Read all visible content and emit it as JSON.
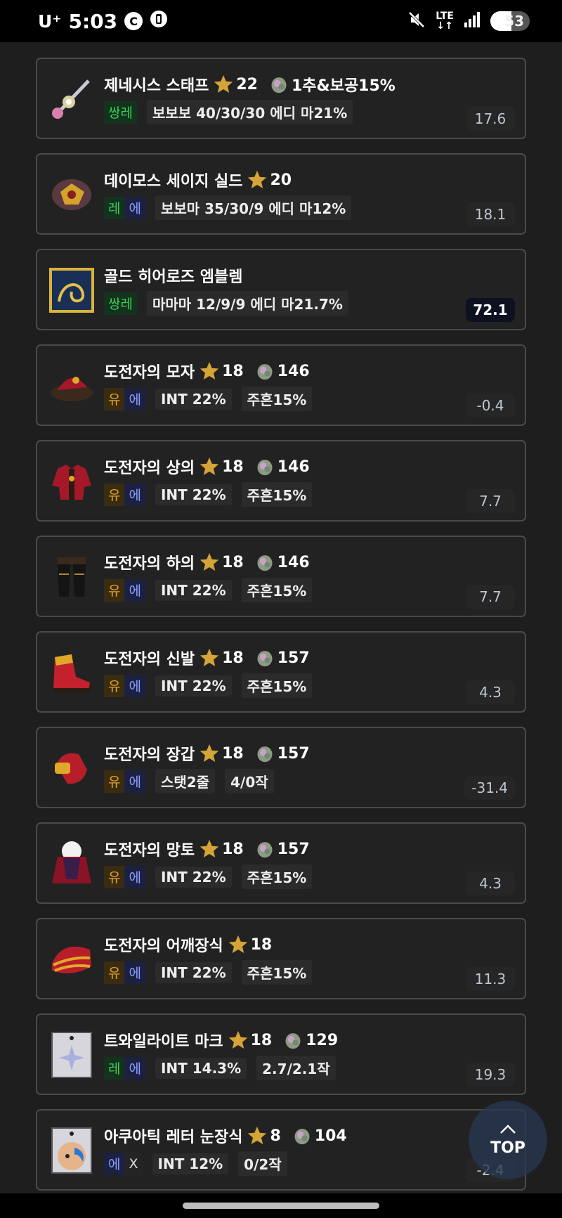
{
  "status_bar": {
    "carrier": "U⁺",
    "time": "5:03",
    "badge_c": "C",
    "lte_top": "LTE",
    "lte_bottom": "↓↑",
    "battery": "53",
    "battery_level": 0.53
  },
  "items": [
    {
      "name": "제네시스 스태프",
      "stars": "22",
      "add": "1추&보공15%",
      "tiers": [
        {
          "text": "쌍레",
          "type": "rare"
        }
      ],
      "stats": [
        "보보보 40/30/30 에디 마21%"
      ],
      "score": "17.6",
      "highlight": false,
      "icon": "staff-icon"
    },
    {
      "name": "데이모스 세이지 실드",
      "stars": "20",
      "add": "",
      "tiers": [
        {
          "text": "레",
          "type": "rare"
        },
        {
          "text": "에",
          "type": "epic"
        }
      ],
      "stats": [
        "보보마 35/30/9 에디 마12%"
      ],
      "score": "18.1",
      "highlight": false,
      "icon": "shield-icon"
    },
    {
      "name": "골드 히어로즈 엠블렘",
      "stars": "",
      "add": "",
      "tiers": [
        {
          "text": "쌍레",
          "type": "rare"
        }
      ],
      "stats": [
        "마마마 12/9/9 에디 마21.7%"
      ],
      "score": "72.1",
      "highlight": true,
      "icon": "emblem-icon"
    },
    {
      "name": "도전자의 모자",
      "stars": "18",
      "add": "146",
      "tiers": [
        {
          "text": "유",
          "type": "unique"
        },
        {
          "text": "에",
          "type": "epic"
        }
      ],
      "stats": [
        "INT 22%",
        "주흔15%"
      ],
      "score": "-0.4",
      "highlight": false,
      "icon": "hat-icon"
    },
    {
      "name": "도전자의 상의",
      "stars": "18",
      "add": "146",
      "tiers": [
        {
          "text": "유",
          "type": "unique"
        },
        {
          "text": "에",
          "type": "epic"
        }
      ],
      "stats": [
        "INT 22%",
        "주흔15%"
      ],
      "score": "7.7",
      "highlight": false,
      "icon": "top-armor-icon"
    },
    {
      "name": "도전자의 하의",
      "stars": "18",
      "add": "146",
      "tiers": [
        {
          "text": "유",
          "type": "unique"
        },
        {
          "text": "에",
          "type": "epic"
        }
      ],
      "stats": [
        "INT 22%",
        "주흔15%"
      ],
      "score": "7.7",
      "highlight": false,
      "icon": "pants-icon"
    },
    {
      "name": "도전자의 신발",
      "stars": "18",
      "add": "157",
      "tiers": [
        {
          "text": "유",
          "type": "unique"
        },
        {
          "text": "에",
          "type": "epic"
        }
      ],
      "stats": [
        "INT 22%",
        "주흔15%"
      ],
      "score": "4.3",
      "highlight": false,
      "icon": "shoes-icon"
    },
    {
      "name": "도전자의 장갑",
      "stars": "18",
      "add": "157",
      "tiers": [
        {
          "text": "유",
          "type": "unique"
        },
        {
          "text": "에",
          "type": "epic"
        }
      ],
      "stats": [
        "스탯2줄",
        "4/0작"
      ],
      "score": "-31.4",
      "highlight": false,
      "icon": "gloves-icon"
    },
    {
      "name": "도전자의 망토",
      "stars": "18",
      "add": "157",
      "tiers": [
        {
          "text": "유",
          "type": "unique"
        },
        {
          "text": "에",
          "type": "epic"
        }
      ],
      "stats": [
        "INT 22%",
        "주흔15%"
      ],
      "score": "4.3",
      "highlight": false,
      "icon": "cape-icon"
    },
    {
      "name": "도전자의 어깨장식",
      "stars": "18",
      "add": "",
      "tiers": [
        {
          "text": "유",
          "type": "unique"
        },
        {
          "text": "에",
          "type": "epic"
        }
      ],
      "stats": [
        "INT 22%",
        "주흔15%"
      ],
      "score": "11.3",
      "highlight": false,
      "icon": "shoulder-icon"
    },
    {
      "name": "트와일라이트 마크",
      "stars": "18",
      "add": "129",
      "tiers": [
        {
          "text": "레",
          "type": "rare"
        },
        {
          "text": "에",
          "type": "epic"
        }
      ],
      "stats": [
        "INT 14.3%",
        "2.7/2.1작"
      ],
      "score": "19.3",
      "highlight": false,
      "icon": "mark-icon"
    },
    {
      "name": "아쿠아틱 레터 눈장식",
      "stars": "8",
      "add": "104",
      "tiers": [
        {
          "text": "에",
          "type": "epic"
        },
        {
          "text": "X",
          "type": "x"
        }
      ],
      "stats": [
        "INT 12%",
        "0/2작"
      ],
      "score": "-2.4",
      "highlight": false,
      "icon": "eye-accessory-icon"
    }
  ],
  "top_button": {
    "label": "TOP"
  }
}
